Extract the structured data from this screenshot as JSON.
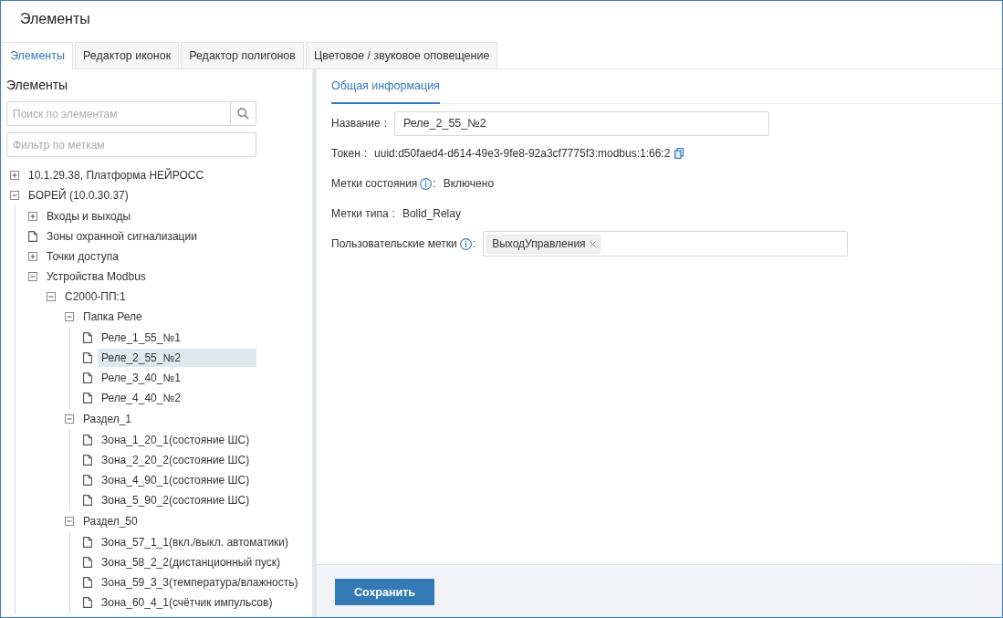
{
  "window": {
    "title": "Элементы"
  },
  "tabs": [
    {
      "label": "Элементы",
      "selected": true
    },
    {
      "label": "Редактор иконок",
      "selected": false
    },
    {
      "label": "Редактор полигонов",
      "selected": false
    },
    {
      "label": "Цветовое / звуковое оповещение",
      "selected": false
    }
  ],
  "sidebar": {
    "heading": "Элементы",
    "search": {
      "placeholder": "Поиск по элементам"
    },
    "filter": {
      "placeholder": "Фильтр по меткам"
    },
    "tree": [
      {
        "label": "10.1.29.38, Платформа НЕЙРОСС",
        "kind": "group",
        "expanded": false,
        "selected": false
      },
      {
        "label": "БОРЕЙ (10.0.30.37)",
        "kind": "group",
        "expanded": true,
        "selected": false,
        "children": [
          {
            "label": "Входы и выходы",
            "kind": "group",
            "expanded": false,
            "selected": false
          },
          {
            "label": "Зоны охранной сигнализации",
            "kind": "leaf",
            "selected": false
          },
          {
            "label": "Точки доступа",
            "kind": "group",
            "expanded": false,
            "selected": false
          },
          {
            "label": "Устройства Modbus",
            "kind": "group",
            "expanded": true,
            "selected": false,
            "children": [
              {
                "label": "С2000-ПП:1",
                "kind": "group",
                "expanded": true,
                "selected": false,
                "children": [
                  {
                    "label": "Папка Реле",
                    "kind": "group",
                    "expanded": true,
                    "selected": false,
                    "children": [
                      {
                        "label": "Реле_1_55_№1",
                        "kind": "leaf",
                        "selected": false
                      },
                      {
                        "label": "Реле_2_55_№2",
                        "kind": "leaf",
                        "selected": true
                      },
                      {
                        "label": "Реле_3_40_№1",
                        "kind": "leaf",
                        "selected": false
                      },
                      {
                        "label": "Реле_4_40_№2",
                        "kind": "leaf",
                        "selected": false
                      }
                    ]
                  },
                  {
                    "label": "Раздел_1",
                    "kind": "group",
                    "expanded": true,
                    "selected": false,
                    "children": [
                      {
                        "label": "Зона_1_20_1(состояние ШС)",
                        "kind": "leaf",
                        "selected": false
                      },
                      {
                        "label": "Зона_2_20_2(состояние ШС)",
                        "kind": "leaf",
                        "selected": false
                      },
                      {
                        "label": "Зона_4_90_1(состояние ШС)",
                        "kind": "leaf",
                        "selected": false
                      },
                      {
                        "label": "Зона_5_90_2(состояние ШС)",
                        "kind": "leaf",
                        "selected": false
                      }
                    ]
                  },
                  {
                    "label": "Раздел_50",
                    "kind": "group",
                    "expanded": true,
                    "selected": false,
                    "children": [
                      {
                        "label": "Зона_57_1_1(вкл./выкл. автоматики)",
                        "kind": "leaf",
                        "selected": false
                      },
                      {
                        "label": "Зона_58_2_2(дистанционный пуск)",
                        "kind": "leaf",
                        "selected": false
                      },
                      {
                        "label": "Зона_59_3_3(температура/влажность)",
                        "kind": "leaf",
                        "selected": false
                      },
                      {
                        "label": "Зона_60_4_1(счётчик импульсов)",
                        "kind": "leaf",
                        "selected": false
                      }
                    ]
                  }
                ]
              }
            ]
          }
        ]
      }
    ]
  },
  "details": {
    "tabs": [
      {
        "label": "Общая информация",
        "selected": true
      }
    ],
    "fields": [
      {
        "kind": "input",
        "label": "Название",
        "separator": ":",
        "value": "Реле_2_55_№2"
      },
      {
        "kind": "text",
        "label": "Токен",
        "separator": ":",
        "value": "uuid:d50faed4-d614-49e3-9fe8-92a3cf7775f3:modbus:1:66:2",
        "copyable": true
      },
      {
        "kind": "text",
        "label": "Метки состояния",
        "info": true,
        "separator": ":",
        "value": "Включено"
      },
      {
        "kind": "text",
        "label": "Метки типа",
        "separator": ":",
        "value": "Bolid_Relay"
      },
      {
        "kind": "tags",
        "label": "Пользовательские метки",
        "info": true,
        "separator": ":",
        "tags": [
          "ВыходУправления"
        ]
      }
    ]
  },
  "footer": {
    "buttons": [
      "Сохранить"
    ]
  }
}
